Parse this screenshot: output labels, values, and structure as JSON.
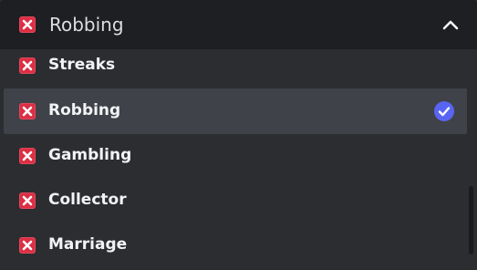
{
  "select": {
    "selected_value": "Robbing",
    "expanded": true,
    "options": [
      {
        "label": "Streaks",
        "selected": false
      },
      {
        "label": "Robbing",
        "selected": true
      },
      {
        "label": "Gambling",
        "selected": false
      },
      {
        "label": "Collector",
        "selected": false
      },
      {
        "label": "Marriage",
        "selected": false
      }
    ]
  },
  "icons": {
    "option_icon": "cross-mark-icon",
    "header_toggle": "chevron-up-icon",
    "selected_marker": "check-circle-icon"
  },
  "colors": {
    "header_background": "#1e1f22",
    "menu_background": "#2b2d31",
    "selected_row": "#404249",
    "accent": "#5865f2",
    "cross_mark": "#dd2e44"
  }
}
